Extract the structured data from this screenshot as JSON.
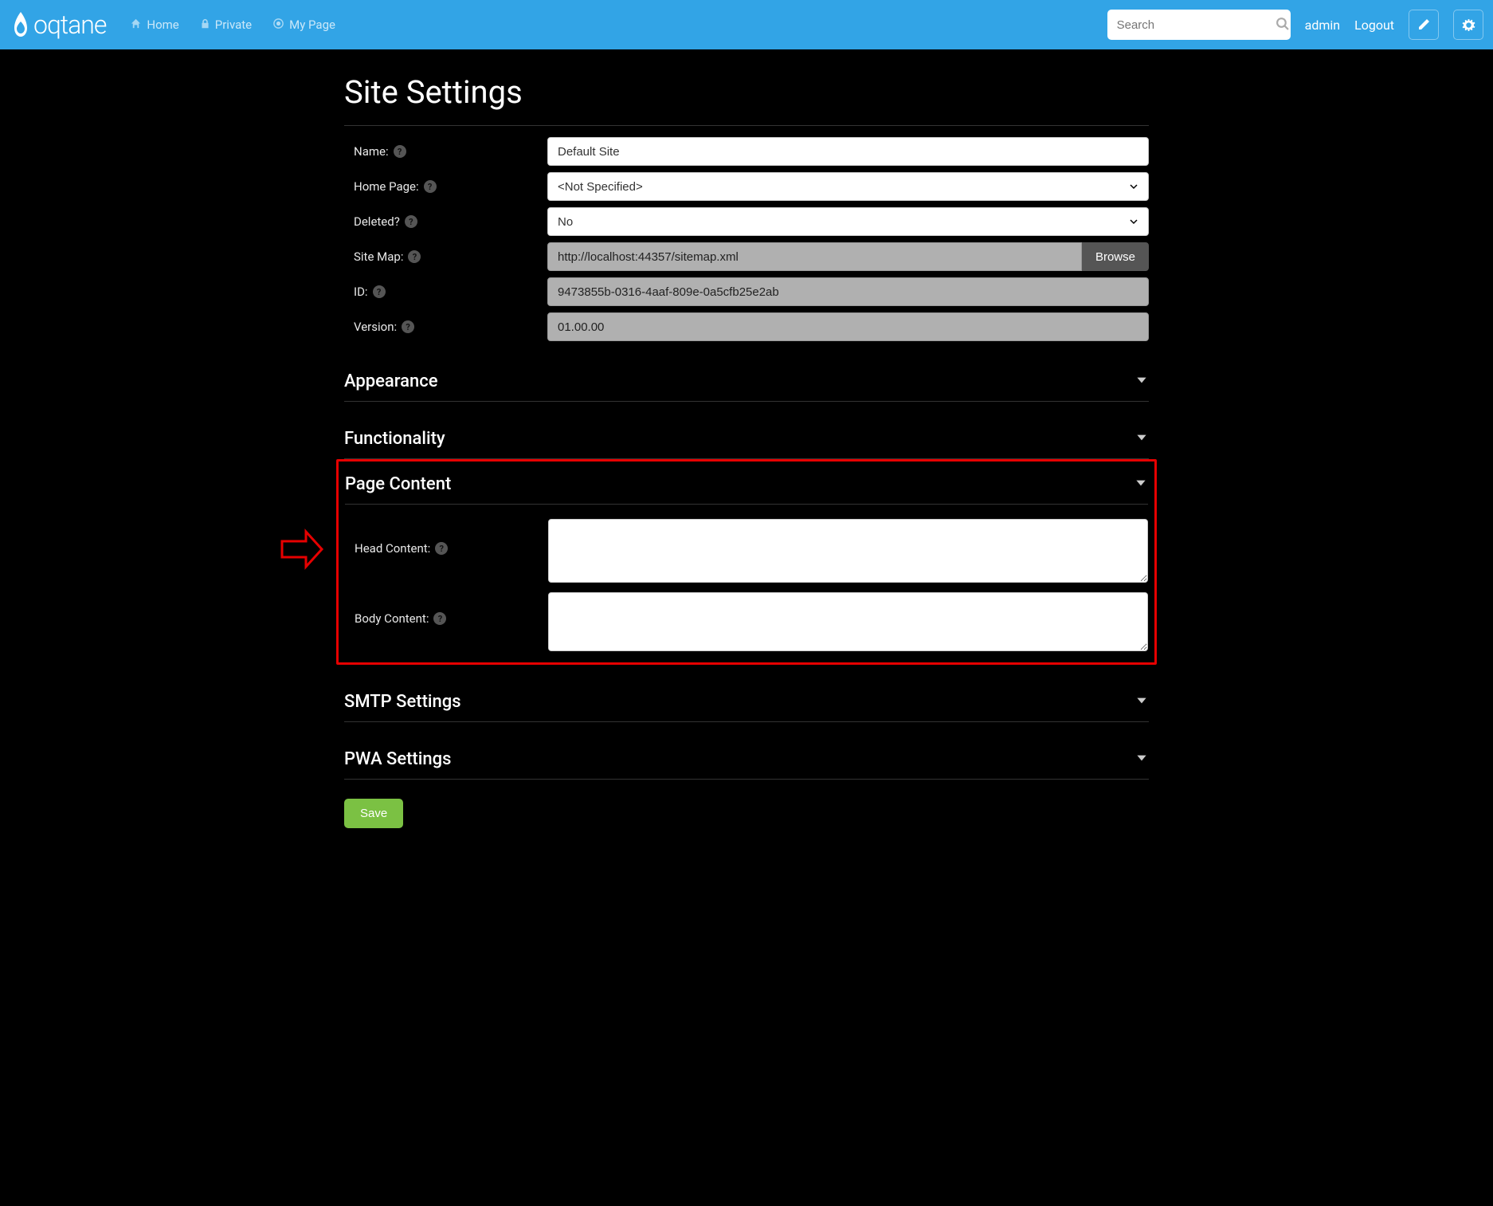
{
  "brand": "oqtane",
  "nav": {
    "home": "Home",
    "private": "Private",
    "mypage": "My Page"
  },
  "search": {
    "placeholder": "Search"
  },
  "user": {
    "name": "admin",
    "logout": "Logout"
  },
  "page": {
    "title": "Site Settings"
  },
  "fields": {
    "name": {
      "label": "Name:",
      "value": "Default Site"
    },
    "homepage": {
      "label": "Home Page:",
      "value": "<Not Specified>"
    },
    "deleted": {
      "label": "Deleted?",
      "value": "No"
    },
    "sitemap": {
      "label": "Site Map:",
      "value": "http://localhost:44357/sitemap.xml",
      "browse": "Browse"
    },
    "id": {
      "label": "ID:",
      "value": "9473855b-0316-4aaf-809e-0a5cfb25e2ab"
    },
    "version": {
      "label": "Version:",
      "value": "01.00.00"
    }
  },
  "sections": {
    "appearance": "Appearance",
    "functionality": "Functionality",
    "pagecontent": "Page Content",
    "smtp": "SMTP Settings",
    "pwa": "PWA Settings"
  },
  "pagecontent": {
    "head": {
      "label": "Head Content:",
      "value": ""
    },
    "body": {
      "label": "Body Content:",
      "value": ""
    }
  },
  "buttons": {
    "save": "Save"
  }
}
